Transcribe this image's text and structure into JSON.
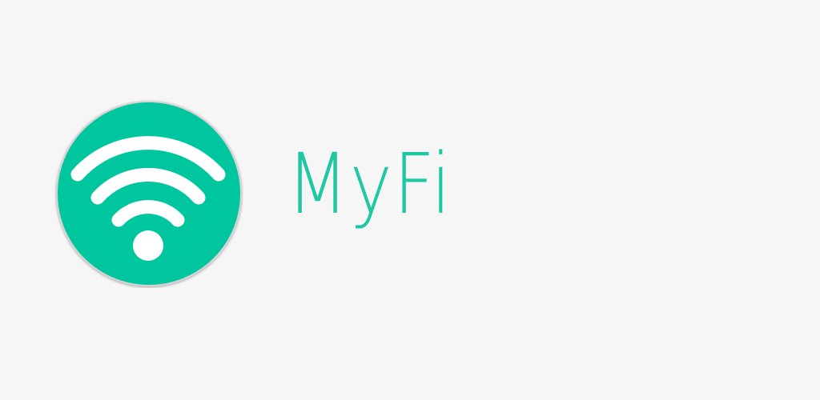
{
  "app": {
    "name": "MyFi"
  },
  "logo": {
    "icon": "wifi-icon",
    "background_color": "#00c6a0",
    "glyph_color": "#ffffff"
  },
  "theme": {
    "page_background": "#f6f6f6",
    "text_color": "#1fc8a2"
  }
}
